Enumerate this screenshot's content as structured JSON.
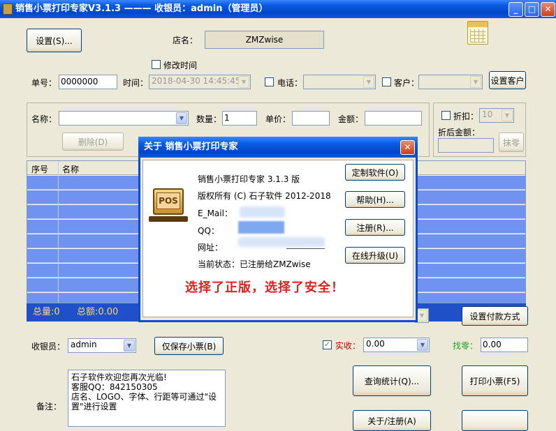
{
  "window": {
    "title": "销售小票打印专家V3.1.3 ——— 收银员：admin（管理员）",
    "minimize": "_",
    "maximize": "□",
    "close": "✕"
  },
  "header": {
    "settings_button": "设置(S)...",
    "shop_name_label": "店名：",
    "shop_name_value": "ZMZwise",
    "modify_time_label": "修改时间",
    "order_no_label": "单号：",
    "order_no_value": "0000000",
    "time_label": "时间：",
    "time_value": "2018-04-30 14:45:45",
    "phone_label": "电话：",
    "customer_label": "客户：",
    "set_customer_button": "设置客户"
  },
  "item_form": {
    "name_label": "名称：",
    "quantity_label": "数量：",
    "quantity_value": "1",
    "unit_price_label": "单价：",
    "amount_label": "金额：",
    "discount_label": "折扣：",
    "discount_value": "10",
    "after_discount_label": "折后金额：",
    "delete_button": "删除(D)",
    "round_button": "抹零"
  },
  "grid": {
    "columns": [
      "序号",
      "名称"
    ],
    "row_count": 9
  },
  "summary": {
    "total_qty": "总量:0",
    "total_amount": "总额:0.00"
  },
  "bottom": {
    "set_payment_button": "设置付款方式",
    "cashier_label": "收银员：",
    "cashier_value": "admin",
    "save_only_button": "仅保存小票(B)",
    "received_label": "实收：",
    "received_value": "0.00",
    "change_label": "找零：",
    "change_value": "0.00",
    "notes_label": "备注：",
    "notes_text": "石子软件欢迎您再次光临!\n客服QQ：842150305\n店名、LOGO、字体、行距等可通过\"设置\"进行设置",
    "query_button": "查询统计(Q)...",
    "print_button": "打印小票(F5)",
    "about_button": "关于/注册(A)"
  },
  "about_dialog": {
    "title": "关于 销售小票打印专家",
    "product": "销售小票打印专家 3.1.3 版",
    "copyright": "版权所有 (C) 石子软件 2012-2018",
    "email_label": "E_Mail：",
    "qq_label": "QQ：",
    "website_label": "网址：",
    "status": "当前状态：已注册给ZMZwise",
    "slogan": "选择了正版，选择了安全！",
    "logo_text": "POS",
    "custom_button": "定制软件(O)",
    "help_button": "帮助(H)...",
    "register_button": "注册(R)...",
    "upgrade_button": "在线升级(U)"
  },
  "colors": {
    "title_bar": "#0a5ae0",
    "grid_row": "#6f93ee",
    "summary_bar": "#1f50c8",
    "summary_text": "#ffd86a",
    "slogan": "#e02020",
    "received_label": "#cc0000",
    "change_label": "#1fa21f"
  }
}
